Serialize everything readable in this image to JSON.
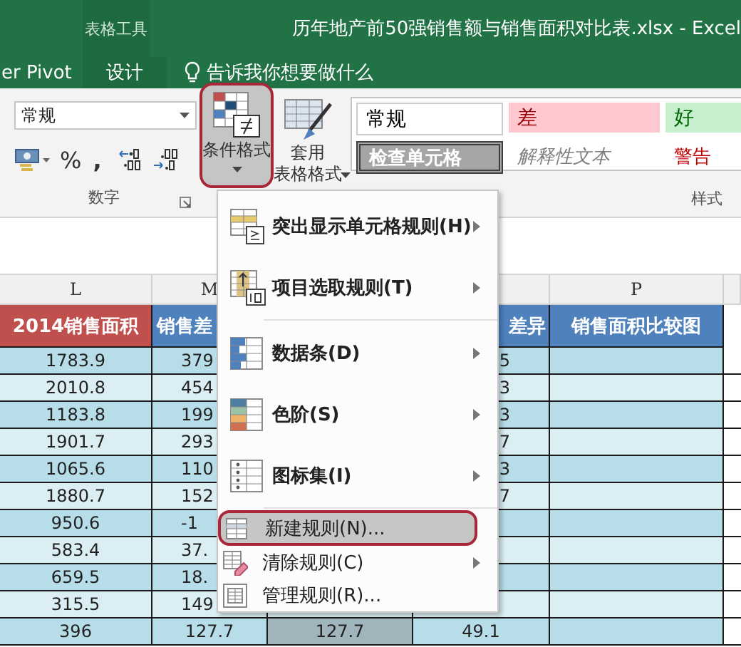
{
  "title_bar": {
    "context_group": "表格工具",
    "title": "历年地产前50强销售额与销售面积对比表.xlsx - Excel"
  },
  "tabs": [
    {
      "label": "er Pivot",
      "contextual": false
    },
    {
      "label": "设计",
      "contextual": true
    }
  ],
  "tell_me": "告诉我你想要做什么",
  "ribbon": {
    "number_format": "常规",
    "percent": "%",
    "comma": ",",
    "number_group_label": "数字",
    "conditional_format": {
      "label": "条件格式",
      "highlighted": true
    },
    "table_format": [
      "套用",
      "表格格式"
    ],
    "styles": [
      {
        "label": "常规",
        "kind": "normal"
      },
      {
        "label": "差",
        "kind": "bad"
      },
      {
        "label": "好",
        "kind": "good"
      },
      {
        "label": "检查单元格",
        "kind": "check"
      },
      {
        "label": "解释性文本",
        "kind": "explanatory"
      },
      {
        "label": "警告",
        "kind": "warning"
      }
    ],
    "styles_group_label": "样式"
  },
  "sheet": {
    "columns": [
      {
        "letter": "L",
        "header": "2014销售面积",
        "color": "#c0504d"
      },
      {
        "letter": "M",
        "header": "销售差",
        "color": "#4f81bd"
      },
      {},
      {
        "header": "差异",
        "color": "#4f81bd"
      },
      {
        "letter": "P",
        "header": "销售面积比较图",
        "color": "#4f81bd"
      }
    ],
    "rows": [
      {
        "cells": [
          {
            "text": "1783.9",
            "selected": false
          },
          {
            "text": "379",
            "selected": false
          },
          {},
          {
            "text": "5",
            "selected": false
          },
          {
            "selected": false
          }
        ]
      },
      {
        "cells": [
          {
            "text": "2010.8",
            "selected": false
          },
          {
            "text": "454",
            "selected": false
          },
          {},
          {
            "text": "3",
            "selected": false
          },
          {
            "selected": false
          }
        ]
      },
      {
        "cells": [
          {
            "text": "1183.8",
            "selected": false
          },
          {
            "text": "199",
            "selected": false
          },
          {},
          {
            "text": "3",
            "selected": false
          },
          {
            "selected": false
          }
        ]
      },
      {
        "cells": [
          {
            "text": "1901.7",
            "selected": false
          },
          {
            "text": "293",
            "selected": false
          },
          {},
          {
            "text": "7",
            "selected": false
          },
          {
            "selected": false
          }
        ]
      },
      {
        "cells": [
          {
            "text": "1065.6",
            "selected": false
          },
          {
            "text": "110",
            "selected": false
          },
          {},
          {
            "text": "3",
            "selected": false
          },
          {
            "selected": false
          }
        ]
      },
      {
        "cells": [
          {
            "text": "1880.7",
            "selected": false
          },
          {
            "text": "152",
            "selected": false
          },
          {},
          {
            "text": "7",
            "selected": false
          },
          {
            "selected": false
          }
        ]
      },
      {
        "cells": [
          {
            "text": "950.6",
            "selected": false
          },
          {
            "text": "-1",
            "selected": false
          },
          {},
          {
            "selected": false
          },
          {
            "selected": false
          }
        ]
      },
      {
        "cells": [
          {
            "text": "583.4",
            "selected": false
          },
          {
            "text": "37.",
            "selected": false
          },
          {},
          {
            "selected": false
          },
          {
            "selected": false
          }
        ]
      },
      {
        "cells": [
          {
            "text": "659.5",
            "selected": false
          },
          {
            "text": "18.",
            "selected": false
          },
          {},
          {
            "selected": false
          },
          {
            "selected": false
          }
        ]
      },
      {
        "cells": [
          {
            "text": "315.5",
            "selected": false
          },
          {
            "text": "149",
            "selected": false
          },
          {},
          {
            "selected": false
          },
          {
            "selected": false
          }
        ]
      },
      {
        "cells": [
          {
            "text": "396",
            "selected": false
          },
          {
            "text": "127.7",
            "selected": false
          },
          {
            "text": "127.7",
            "selected": true
          },
          {
            "text": "49.1",
            "selected": false
          },
          {
            "selected": false
          }
        ]
      }
    ]
  },
  "menu": {
    "items": [
      {
        "kind": "highlight",
        "label": "突出显示单元格规则(H)",
        "submenu": true,
        "selected": false
      },
      {
        "kind": "top",
        "label": "项目选取规则(T)",
        "submenu": true,
        "selected": false
      },
      {
        "kind": "databar",
        "label": "数据条(D)",
        "submenu": true,
        "selected": false
      },
      {
        "kind": "colorscale",
        "label": "色阶(S)",
        "submenu": true,
        "selected": false
      },
      {
        "kind": "iconset",
        "label": "图标集(I)",
        "submenu": true,
        "selected": false
      },
      {
        "kind": "new",
        "label": "新建规则(N)...",
        "submenu": false,
        "selected": true
      },
      {
        "kind": "clear",
        "label": "清除规则(C)",
        "submenu": true,
        "selected": false
      },
      {
        "kind": "manage",
        "label": "管理规则(R)...",
        "submenu": false,
        "selected": false
      }
    ]
  }
}
